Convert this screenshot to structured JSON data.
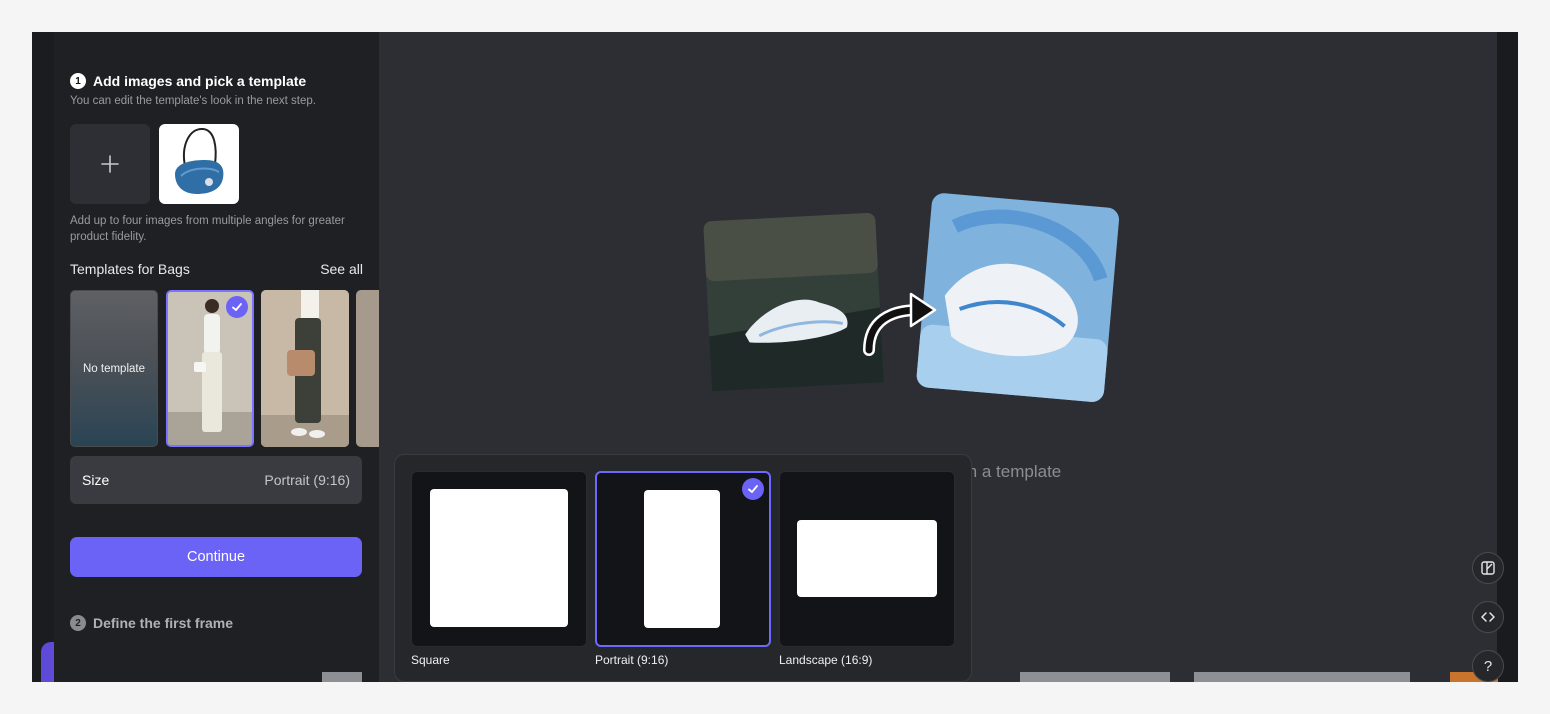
{
  "step1": {
    "number": "1",
    "title": "Add images and pick a template",
    "subtitle": "You can edit the template's look in the next step.",
    "images_hint": "Add up to four images from multiple angles for greater product fidelity."
  },
  "templates": {
    "title": "Templates for Bags",
    "see_all": "See all",
    "no_template_label": "No template"
  },
  "size": {
    "label": "Size",
    "value": "Portrait (9:16)"
  },
  "continue_label": "Continue",
  "step2": {
    "number": "2",
    "title": "Define the first frame"
  },
  "canvas": {
    "partial_text": "m a template"
  },
  "size_options": [
    {
      "label": "Square",
      "selected": false
    },
    {
      "label": "Portrait (9:16)",
      "selected": true
    },
    {
      "label": "Landscape (16:9)",
      "selected": false
    }
  ],
  "right_tools": {
    "help_label": "?"
  },
  "colors": {
    "accent": "#6b63f5",
    "panel": "#1f2023",
    "canvas": "#2d2e33"
  }
}
